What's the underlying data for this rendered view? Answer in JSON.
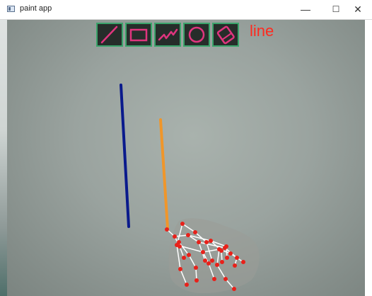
{
  "window": {
    "title": "paint app",
    "controls": {
      "minimize": "—",
      "maximize": "☐",
      "close": "✕"
    }
  },
  "toolbar": {
    "tools": [
      {
        "name": "line",
        "icon": "line-icon"
      },
      {
        "name": "rectangle",
        "icon": "rectangle-icon"
      },
      {
        "name": "freehand",
        "icon": "squiggle-icon"
      },
      {
        "name": "circle",
        "icon": "circle-icon"
      },
      {
        "name": "eraser",
        "icon": "eraser-icon"
      }
    ],
    "selected_mode_label": "line"
  },
  "colors": {
    "tool_background": "#262d2a",
    "tool_border": "#3aa36a",
    "tool_icon": "#e0357e",
    "mode_label": "#ff2a1f",
    "stroke_blue": "#0a1a8c",
    "stroke_orange": "#f0962a",
    "landmark": "#e8211a",
    "skeleton": "#ffffff"
  },
  "canvas": {
    "strokes": [
      {
        "color": "#0a1a8c",
        "tool": "line"
      },
      {
        "color": "#f0962a",
        "tool": "line"
      }
    ]
  }
}
